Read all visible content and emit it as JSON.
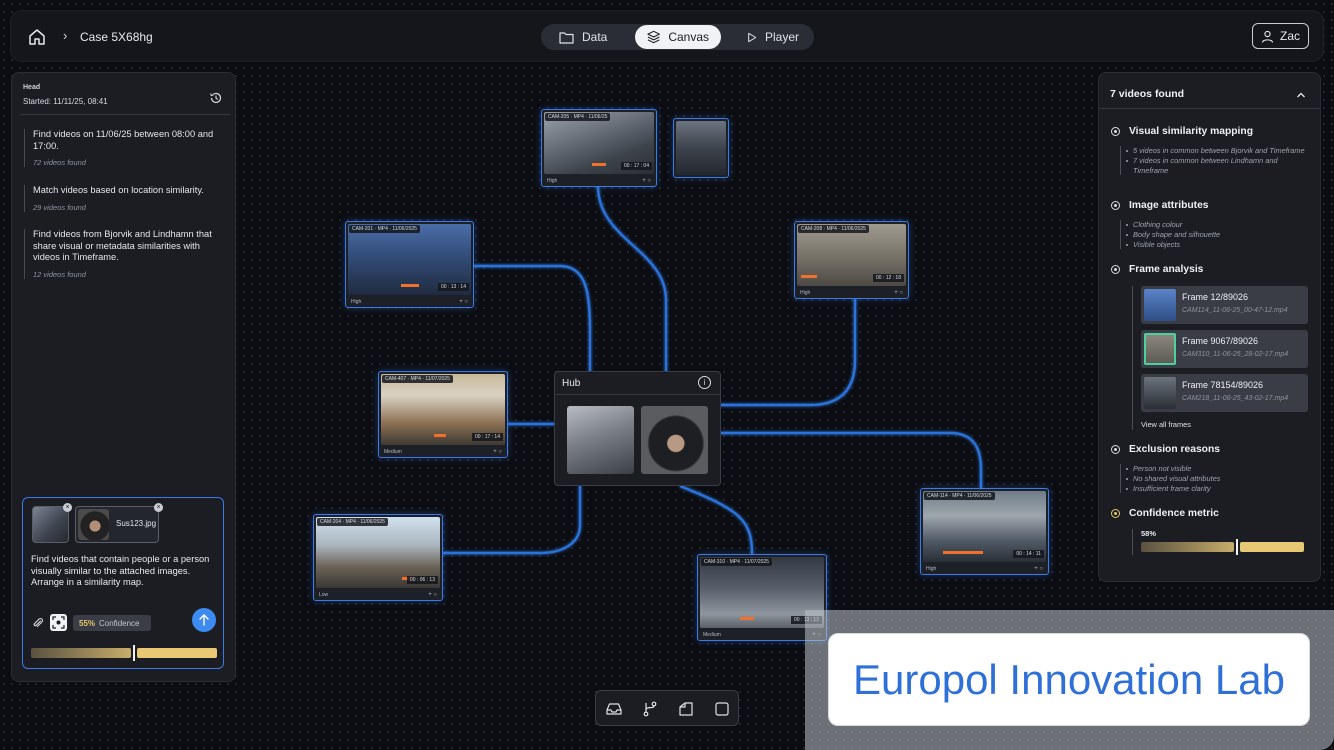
{
  "header": {
    "breadcrumb": "Case 5X68hg",
    "tabs": [
      {
        "label": "Data",
        "icon": "folder-icon"
      },
      {
        "label": "Canvas",
        "icon": "layers-icon"
      },
      {
        "label": "Player",
        "icon": "play-icon"
      }
    ],
    "active_tab": "Canvas",
    "user": "Zac"
  },
  "left_panel": {
    "head_label": "Head",
    "started": "Started: 11/11/25, 08:41",
    "steps": [
      {
        "text": "Find videos on 11/06/25 between 08:00 and 17:00.",
        "meta": "72 videos found"
      },
      {
        "text": "Match videos based on location similarity.",
        "meta": "29 videos found"
      },
      {
        "text": "Find videos from Bjorvik and Lindhamn that share visual or metadata similarities with videos in Timeframe.",
        "meta": "12 videos found"
      }
    ],
    "prompt": {
      "attachment_name": "Sus123.jpg",
      "text": "Find videos that contain people or a person visually similar to the attached images. Arrange in a similarity map.",
      "confidence_pct": "55%",
      "confidence_label": "Confidence",
      "confidence_value": 0.55
    }
  },
  "canvas": {
    "hub_title": "Hub",
    "videos": [
      {
        "cam": "CAM-205",
        "format": "MP4",
        "date": "11/06/25",
        "time": "00 : 17 : 04",
        "quality": "High"
      },
      {
        "cam": "CAM-201",
        "format": "MP4",
        "date": "11/06/2025",
        "time": "00 : 13 : 14",
        "quality": "High"
      },
      {
        "cam": "CAM-208",
        "format": "MP4",
        "date": "11/06/2025",
        "time": "00 : 12 : 18",
        "quality": "High"
      },
      {
        "cam": "CAM-407",
        "format": "MP4",
        "date": "11/07/2025",
        "time": "00 : 17 : 14",
        "quality": "Medium"
      },
      {
        "cam": "CAM-204",
        "format": "MP4",
        "date": "11/06/2025",
        "time": "00 : 06 : 13",
        "quality": "Low"
      },
      {
        "cam": "CAM-310",
        "format": "MP4",
        "date": "11/07/2025",
        "time": "00 : 13 : 12",
        "quality": "Medium"
      },
      {
        "cam": "CAM-114",
        "format": "MP4",
        "date": "11/06/2025",
        "time": "00 : 14 : 11",
        "quality": "High"
      }
    ]
  },
  "right_panel": {
    "title": "7 videos found",
    "sections": [
      {
        "title": "Visual similarity mapping",
        "items": [
          "5 videos in common between Bjorvik and Timeframe",
          "7 videos in common between Lindhamn and Timeframe"
        ]
      },
      {
        "title": "Image attributes",
        "items": [
          "Clothing colour",
          "Body shape and silhouette",
          "Visible objects"
        ]
      },
      {
        "title": "Frame analysis",
        "items": []
      },
      {
        "title": "Exclusion reasons",
        "items": [
          "Person not visible",
          "No shared visual attributes",
          "Insufficient frame clarity"
        ]
      },
      {
        "title": "Confidence metric",
        "items": []
      }
    ],
    "frames": [
      {
        "title": "Frame 12/89026",
        "file": "CAM114_11-06-25_00-47-12.mp4"
      },
      {
        "title": "Frame 9067/89026",
        "file": "CAM310_11-06-25_28-02-17.mp4"
      },
      {
        "title": "Frame 78154/89026",
        "file": "CAM218_11-06-25_43-02-17.mp4"
      }
    ],
    "view_all": "View all frames",
    "confidence_pct": "58%",
    "confidence_value": 0.58
  },
  "watermark": "Europol Innovation Lab",
  "colors": {
    "accent": "#3a7be8",
    "gold": "#e5c76b",
    "send": "#3d8bf0"
  }
}
